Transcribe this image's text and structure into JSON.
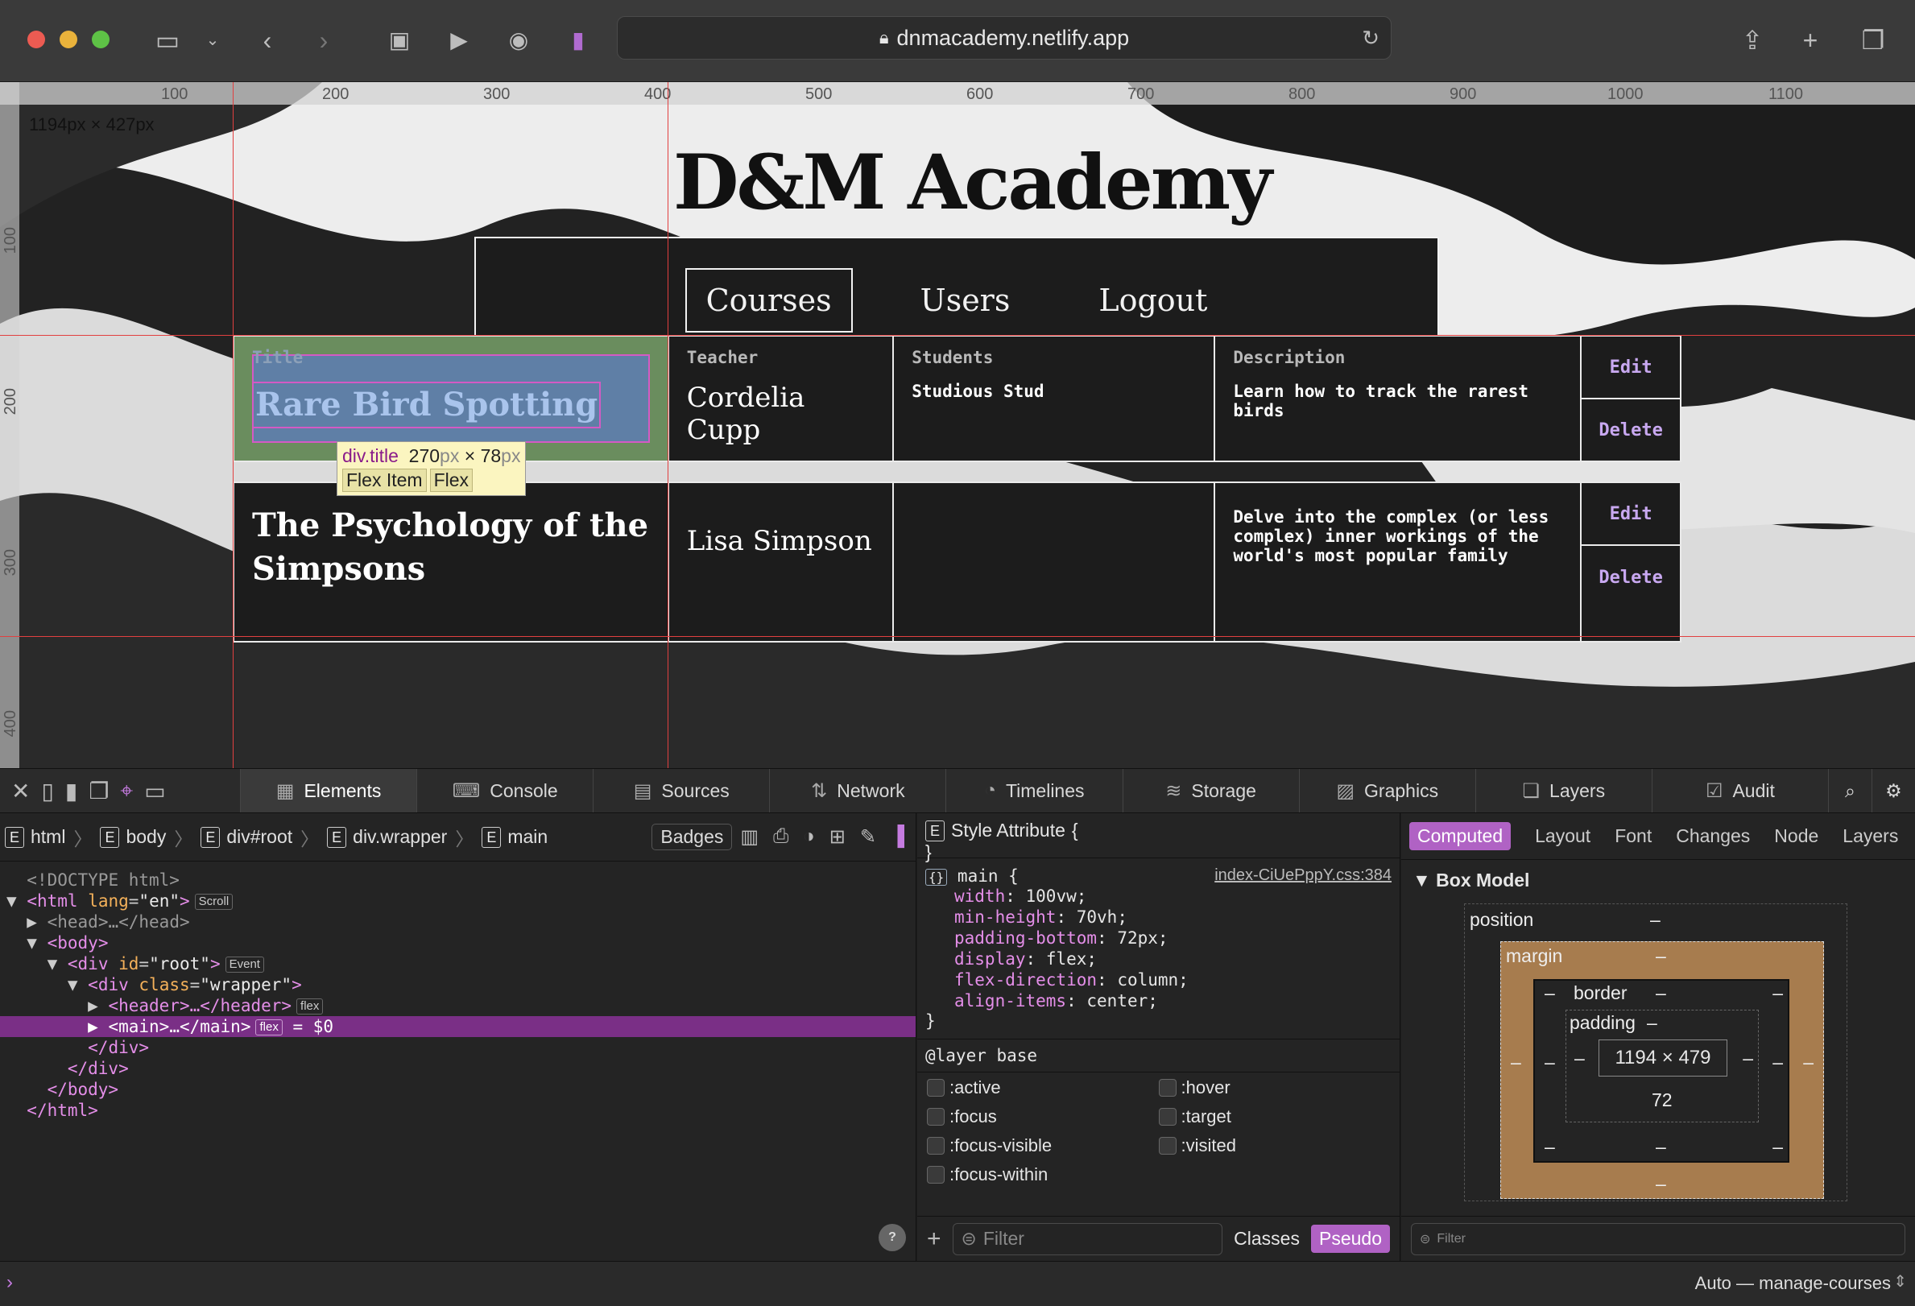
{
  "browser": {
    "url": "dnmacademy.netlify.app"
  },
  "page": {
    "site_title": "D&M Academy",
    "nav": [
      "Courses",
      "Users",
      "Logout"
    ],
    "column_labels": {
      "title": "Title",
      "teacher": "Teacher",
      "students": "Students",
      "description": "Description"
    },
    "rows": [
      {
        "title": "Rare Bird Spotting",
        "teacher": "Cordelia Cupp",
        "students": "Studious Stud",
        "description": "Learn how to track the rarest birds",
        "edit": "Edit",
        "delete": "Delete"
      },
      {
        "title": "The Psychology of the Simpsons",
        "teacher": "Lisa Simpson",
        "students": "",
        "description": "Delve into the complex (or less complex) inner workings of the world's most popular family",
        "edit": "Edit",
        "delete": "Delete"
      }
    ]
  },
  "overlay": {
    "page_size": "1194px × 427px",
    "ruler_top": [
      "100",
      "200",
      "300",
      "400",
      "500",
      "600",
      "700",
      "800",
      "900",
      "1000",
      "1100"
    ],
    "ruler_left": [
      "100",
      "200",
      "300",
      "400"
    ],
    "tooltip_selector": "div.title",
    "tooltip_w": "270",
    "tooltip_h": "78",
    "tooltip_unit": "px",
    "tooltip_x": "×",
    "tooltip_tags": [
      "Flex Item",
      "Flex"
    ]
  },
  "devtools": {
    "tabs": [
      "Elements",
      "Console",
      "Sources",
      "Network",
      "Timelines",
      "Storage",
      "Graphics",
      "Layers",
      "Audit"
    ],
    "breadcrumbs": [
      "html",
      "body",
      "div#root",
      "div.wrapper",
      "main"
    ],
    "badges_label": "Badges",
    "dom": {
      "doctype": "<!DOCTYPE html>",
      "html_badge": "Scroll",
      "root_badge": "Event",
      "header_badge": "flex",
      "main_badge": "flex",
      "sel_ref": "= $0"
    },
    "styles": {
      "style_attr": "Style Attribute",
      "selector": "main",
      "source": "index-CiUePppY.css:384",
      "props": [
        {
          "name": "width",
          "value": "100vw"
        },
        {
          "name": "min-height",
          "value": "70vh"
        },
        {
          "name": "padding-bottom",
          "value": "72px"
        },
        {
          "name": "display",
          "value": "flex"
        },
        {
          "name": "flex-direction",
          "value": "column"
        },
        {
          "name": "align-items",
          "value": "center"
        }
      ],
      "layer": "@layer base",
      "pseudo": [
        ":active",
        ":hover",
        ":focus",
        ":target",
        ":focus-visible",
        ":visited",
        ":focus-within"
      ],
      "filter_placeholder": "Filter",
      "classes": "Classes",
      "pseudo_btn": "Pseudo"
    },
    "computed": {
      "tabs": [
        "Computed",
        "Layout",
        "Font",
        "Changes",
        "Node",
        "Layers"
      ],
      "section": "Box Model",
      "position": "position",
      "margin": "margin",
      "border": "border",
      "padding": "padding",
      "dash": "–",
      "content_size": "1194 × 479",
      "padding_bottom": "72",
      "filter_placeholder": "Filter"
    },
    "console_target": "Auto — manage-courses"
  },
  "colors": {
    "accent": "#7a2f86",
    "link": "#c8a8f0",
    "pill": "#b062c4"
  }
}
